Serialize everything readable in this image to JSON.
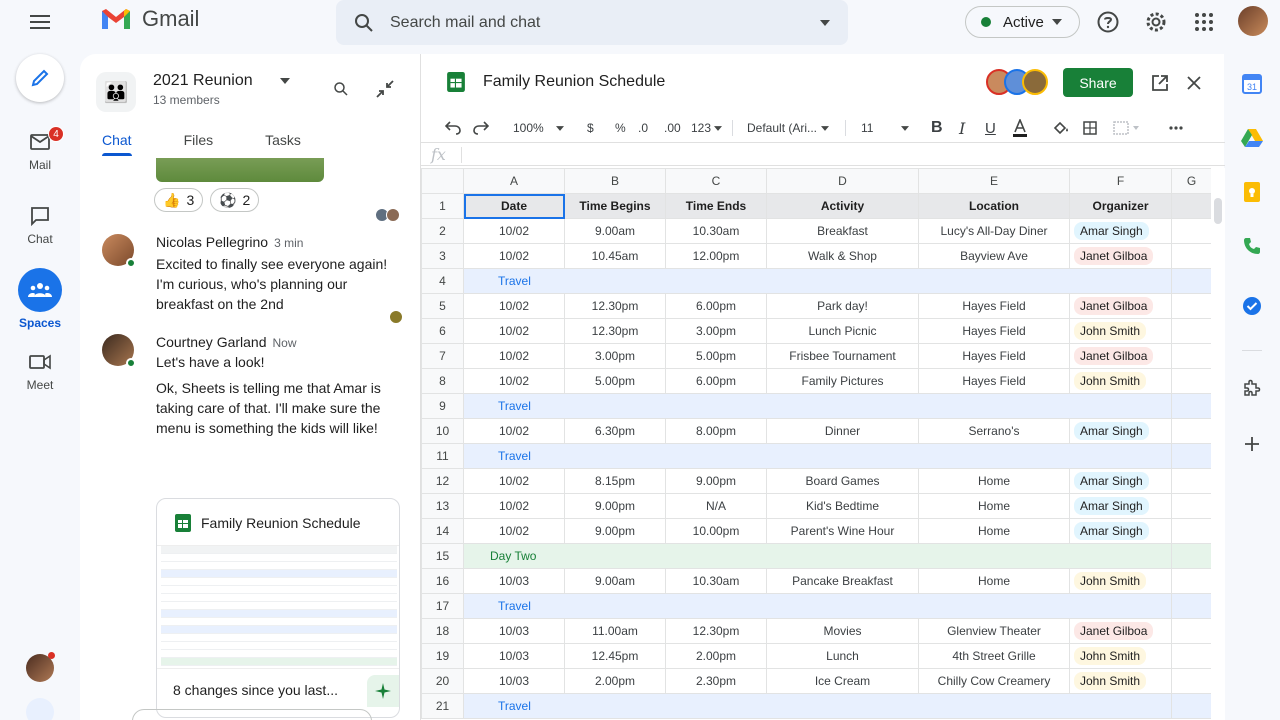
{
  "app": {
    "name": "Gmail"
  },
  "search": {
    "placeholder": "Search mail and chat"
  },
  "status": {
    "label": "Active",
    "color": "#188038"
  },
  "top_icons": [
    "help-icon",
    "settings-icon",
    "apps-grid-icon"
  ],
  "rail": {
    "mail": {
      "label": "Mail",
      "badge": "4"
    },
    "chat": {
      "label": "Chat"
    },
    "spaces": {
      "label": "Spaces"
    },
    "meet": {
      "label": "Meet"
    }
  },
  "space": {
    "name": "2021 Reunion",
    "members": "13 members",
    "tabs": [
      "Chat",
      "Files",
      "Tasks"
    ],
    "reactions": [
      {
        "emoji": "👍",
        "count": "3"
      },
      {
        "emoji": "⚽",
        "count": "2"
      }
    ],
    "messages": [
      {
        "name": "Nicolas Pellegrino",
        "time": "3 min",
        "text": "Excited to finally see everyone again! I'm curious, who's planning our breakfast on the 2nd"
      },
      {
        "name": "Courtney Garland",
        "time": "Now",
        "text1": "Let's have a look!",
        "text2": "Ok, Sheets is telling me that Amar is taking care of that. I'll make sure the menu is something the kids will like!"
      }
    ],
    "attachment": {
      "title": "Family Reunion Schedule",
      "footer": "8 changes since you last..."
    }
  },
  "sheet": {
    "title": "Family Reunion Schedule",
    "share_label": "Share",
    "toolbar": {
      "zoom": "100%",
      "currency": "$",
      "percent": "%",
      "dec_less": ".0",
      "dec_more": ".00",
      "format": "123",
      "font": "Default (Ari...",
      "size": "11"
    },
    "columns": [
      "A",
      "B",
      "C",
      "D",
      "E",
      "F",
      "G"
    ],
    "headers": [
      "Date",
      "Time Begins",
      "Time Ends",
      "Activity",
      "Location",
      "Organizer"
    ],
    "rows": [
      {
        "n": "2",
        "type": "data",
        "cells": [
          "10/02",
          "9.00am",
          "10.30am",
          "Breakfast",
          "Lucy's All-Day Diner",
          "Amar Singh"
        ],
        "chip": "blue"
      },
      {
        "n": "3",
        "type": "data",
        "cells": [
          "10/02",
          "10.45am",
          "12.00pm",
          "Walk & Shop",
          "Bayview Ave",
          "Janet Gilboa"
        ],
        "chip": "red"
      },
      {
        "n": "4",
        "type": "travel",
        "label": "Travel"
      },
      {
        "n": "5",
        "type": "data",
        "cells": [
          "10/02",
          "12.30pm",
          "6.00pm",
          "Park day!",
          "Hayes Field",
          "Janet Gilboa"
        ],
        "chip": "red"
      },
      {
        "n": "6",
        "type": "data",
        "cells": [
          "10/02",
          "12.30pm",
          "3.00pm",
          "Lunch Picnic",
          "Hayes Field",
          "John Smith"
        ],
        "chip": "yellow"
      },
      {
        "n": "7",
        "type": "data",
        "cells": [
          "10/02",
          "3.00pm",
          "5.00pm",
          "Frisbee Tournament",
          "Hayes Field",
          "Janet Gilboa"
        ],
        "chip": "red"
      },
      {
        "n": "8",
        "type": "data",
        "cells": [
          "10/02",
          "5.00pm",
          "6.00pm",
          "Family Pictures",
          "Hayes Field",
          "John Smith"
        ],
        "chip": "yellow"
      },
      {
        "n": "9",
        "type": "travel",
        "label": "Travel"
      },
      {
        "n": "10",
        "type": "data",
        "cells": [
          "10/02",
          "6.30pm",
          "8.00pm",
          "Dinner",
          "Serrano's",
          "Amar Singh"
        ],
        "chip": "blue"
      },
      {
        "n": "11",
        "type": "travel",
        "label": "Travel"
      },
      {
        "n": "12",
        "type": "data",
        "cells": [
          "10/02",
          "8.15pm",
          "9.00pm",
          "Board Games",
          "Home",
          "Amar Singh"
        ],
        "chip": "blue"
      },
      {
        "n": "13",
        "type": "data",
        "cells": [
          "10/02",
          "9.00pm",
          "N/A",
          "Kid's Bedtime",
          "Home",
          "Amar Singh"
        ],
        "chip": "blue"
      },
      {
        "n": "14",
        "type": "data",
        "cells": [
          "10/02",
          "9.00pm",
          "10.00pm",
          "Parent's Wine Hour",
          "Home",
          "Amar Singh"
        ],
        "chip": "blue"
      },
      {
        "n": "15",
        "type": "daytwo",
        "label": "Day Two"
      },
      {
        "n": "16",
        "type": "data",
        "cells": [
          "10/03",
          "9.00am",
          "10.30am",
          "Pancake Breakfast",
          "Home",
          "John Smith"
        ],
        "chip": "yellow"
      },
      {
        "n": "17",
        "type": "travel",
        "label": "Travel"
      },
      {
        "n": "18",
        "type": "data",
        "cells": [
          "10/03",
          "11.00am",
          "12.30pm",
          "Movies",
          "Glenview Theater",
          "Janet Gilboa"
        ],
        "chip": "red"
      },
      {
        "n": "19",
        "type": "data",
        "cells": [
          "10/03",
          "12.45pm",
          "2.00pm",
          "Lunch",
          "4th Street Grille",
          "John Smith"
        ],
        "chip": "yellow"
      },
      {
        "n": "20",
        "type": "data",
        "cells": [
          "10/03",
          "2.00pm",
          "2.30pm",
          "Ice Cream",
          "Chilly Cow Creamery",
          "John Smith"
        ],
        "chip": "yellow"
      },
      {
        "n": "21",
        "type": "travel",
        "label": "Travel"
      }
    ]
  },
  "colors": {
    "accent": "#0b57d0",
    "share": "#188038",
    "travel_band": "#e8f0fe",
    "day_band": "#e6f4ea"
  }
}
